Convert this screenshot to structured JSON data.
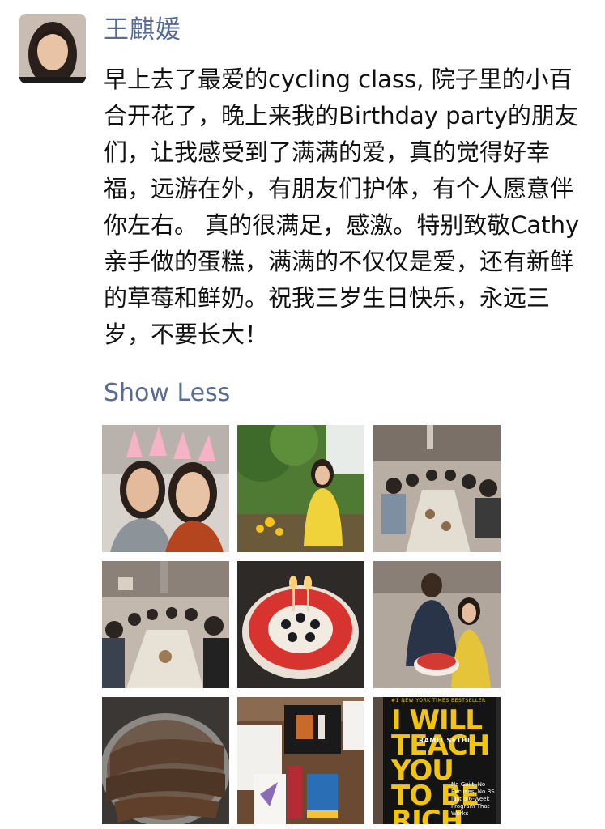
{
  "post": {
    "author": "王麒媛",
    "text": "早上去了最爱的cycling class, 院子里的小百合开花了，晚上来我的Birthday party的朋友们，让我感受到了满满的爱，真的觉得好幸福，远游在外，有朋友们护体，有个人愿意伴你左右。 真的很满足，感激。特别致敬Cathy 亲手做的蛋糕，满满的不仅仅是爱，还有新鲜的草莓和鲜奶。祝我三岁生日快乐，永远三岁，不要长大！",
    "show_less_label": "Show Less"
  },
  "book": {
    "top_label": "#1 NEW YORK TIMES BESTSELLER",
    "title": "I WILL TEACH YOU TO BE RICH",
    "author": "RAMIT SETHI",
    "blurb": "No Guilt. No Excuses. No BS. Just a 6-Week Program That Works"
  },
  "colors": {
    "link": "#576b95",
    "text": "#111111",
    "book_yellow": "#f1c40f"
  }
}
